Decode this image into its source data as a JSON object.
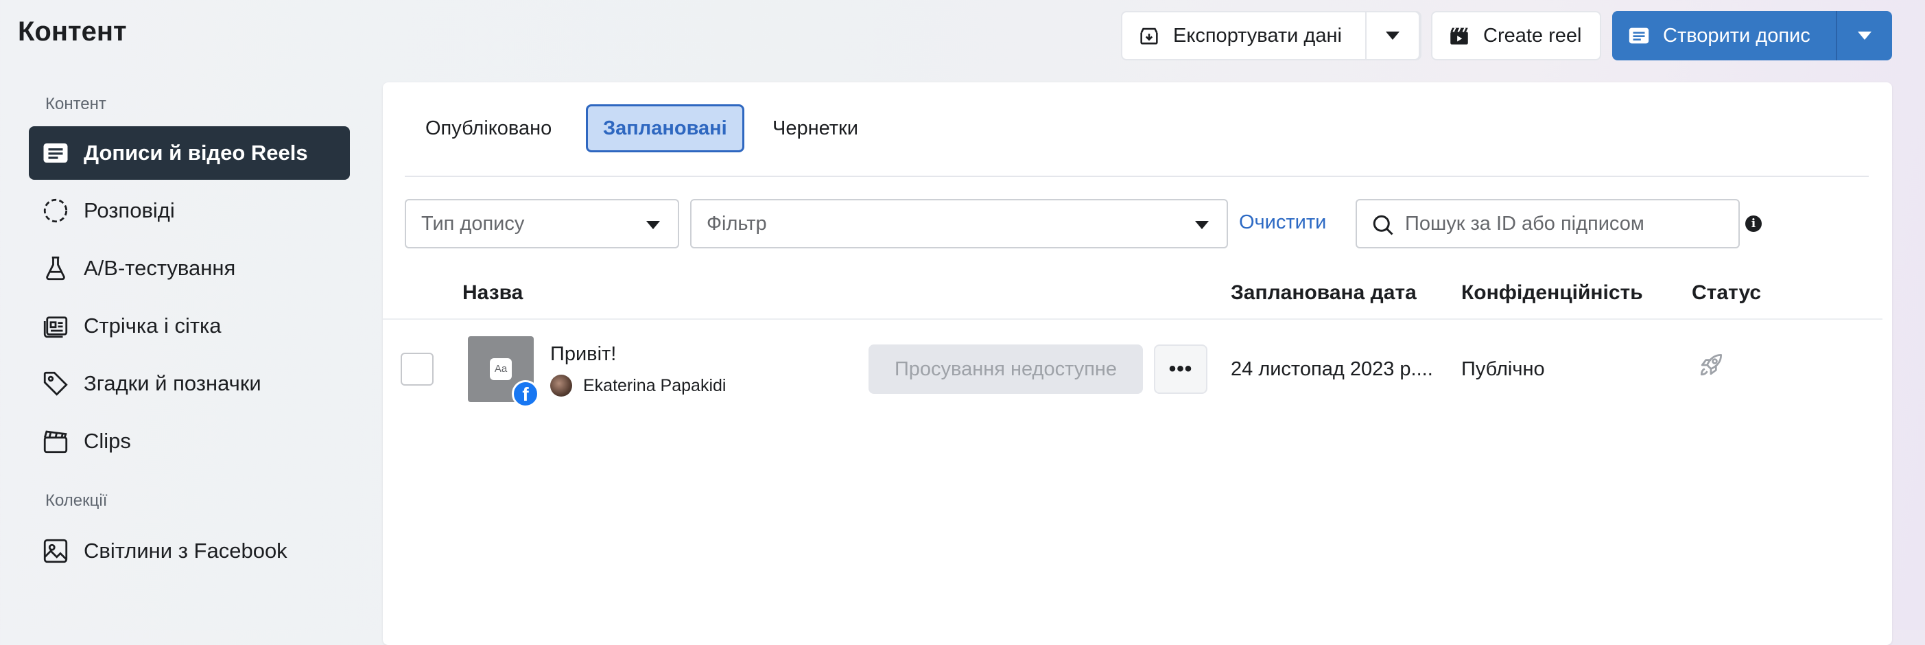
{
  "page": {
    "title": "Контент"
  },
  "header": {
    "export_label": "Експортувати дані",
    "create_reel_label": "Create reel",
    "create_post_label": "Створити допис"
  },
  "sidebar": {
    "section_content": "Контент",
    "items": [
      {
        "label": "Дописи й відео Reels",
        "icon": "posts-icon",
        "active": true
      },
      {
        "label": "Розповіді",
        "icon": "stories-icon",
        "active": false
      },
      {
        "label": "A/B-тестування",
        "icon": "flask-icon",
        "active": false
      },
      {
        "label": "Стрічка і сітка",
        "icon": "feed-grid-icon",
        "active": false
      },
      {
        "label": "Згадки й позначки",
        "icon": "tag-icon",
        "active": false
      },
      {
        "label": "Clips",
        "icon": "clapperboard-icon",
        "active": false
      }
    ],
    "section_collections": "Колекції",
    "collections": [
      {
        "label": "Світлини з Facebook",
        "icon": "photo-icon"
      }
    ]
  },
  "tabs": [
    {
      "label": "Опубліковано",
      "active": false
    },
    {
      "label": "Заплановані",
      "active": true
    },
    {
      "label": "Чернетки",
      "active": false
    }
  ],
  "filters": {
    "post_type_placeholder": "Тип допису",
    "filter_placeholder": "Фільтр",
    "clear_label": "Очистити",
    "search_placeholder": "Пошук за ID або підписом"
  },
  "table": {
    "headers": {
      "name": "Назва",
      "scheduled_date": "Запланована дата",
      "privacy": "Конфіденційність",
      "status": "Статус"
    },
    "rows": [
      {
        "title": "Привіт!",
        "thumb_text": "Aa",
        "author": "Ekaterina Papakidi",
        "promo_label": "Просування недоступне",
        "more_label": "•••",
        "scheduled_date": "24 листопад 2023 р....",
        "privacy": "Публічно",
        "status_icon": "rocket-icon"
      }
    ]
  },
  "colors": {
    "accent_blue": "#3578c4",
    "active_sidebar": "#27333f",
    "active_tab_bg": "#c8dbf6",
    "link": "#2d6ac4"
  }
}
